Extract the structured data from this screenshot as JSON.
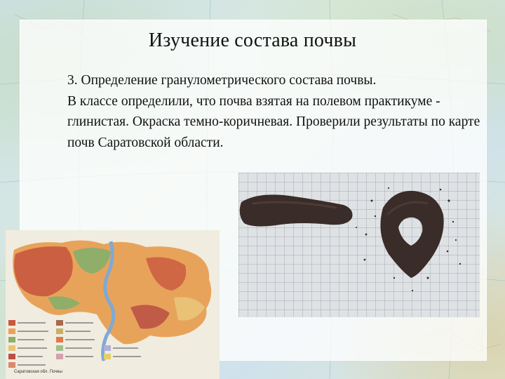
{
  "slide": {
    "title": "Изучение состава почвы",
    "paragraphs": [
      "3. Определение гранулометрического состава почвы.",
      "В классе определили, что почва  взятая на полевом практикуме - глинистая. Окраска темно-коричневая. Проверили результаты по карте почв Саратовской области."
    ]
  },
  "map_image": {
    "caption": "Саратовская обл. Почвы"
  },
  "colors": {
    "panel": "#ffffff",
    "soil": "#3a2c28",
    "map_orange": "#e8a35a",
    "map_red": "#c8583e",
    "map_green": "#8fae6a"
  }
}
